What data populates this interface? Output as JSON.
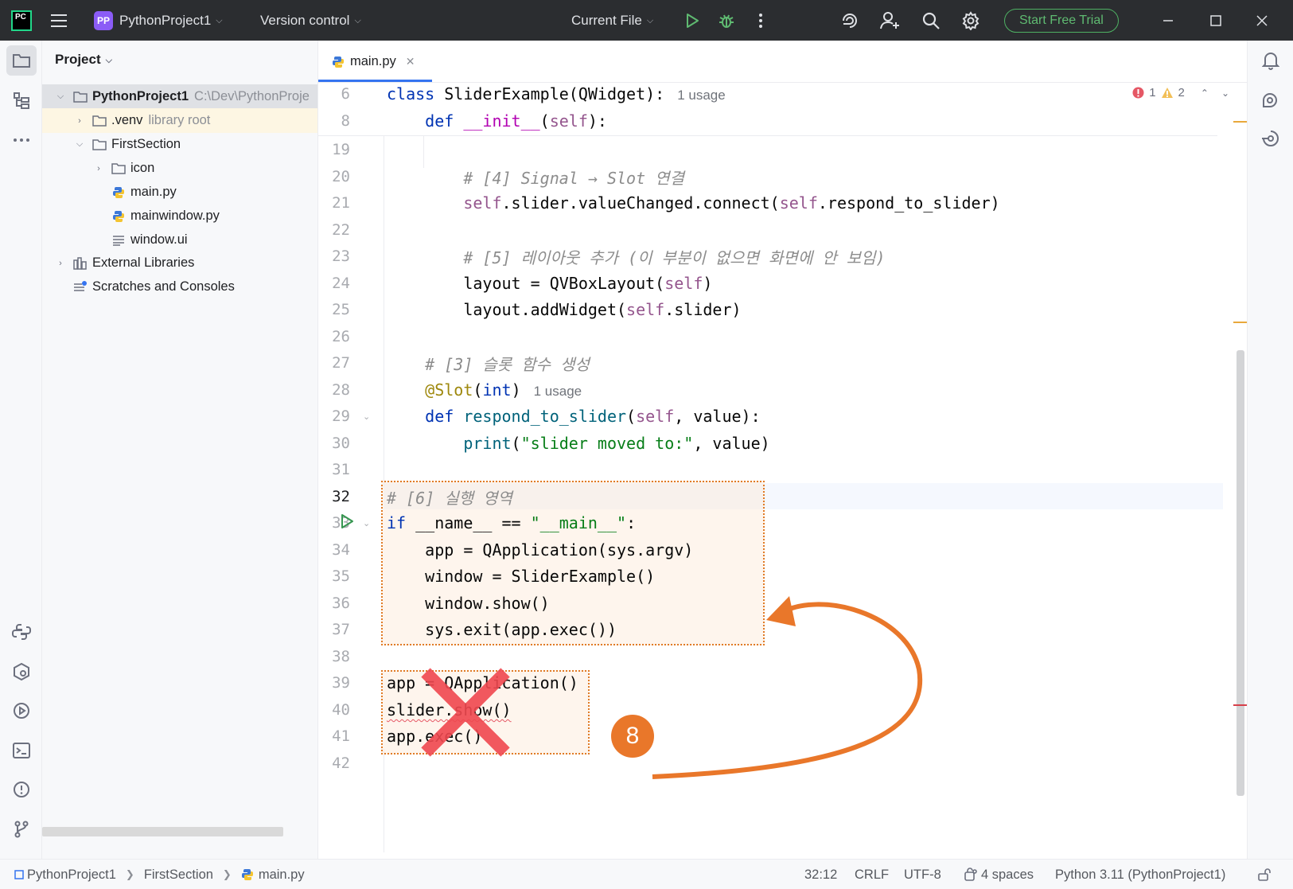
{
  "titlebar": {
    "logo_text": "PC",
    "project_badge": "PP",
    "project_name": "PythonProject1",
    "vcs_label": "Version control",
    "run_config": "Current File",
    "trial_button": "Start Free Trial"
  },
  "project_panel": {
    "title": "Project",
    "tree": [
      {
        "label": "PythonProject1",
        "extra": "C:\\Dev\\PythonProje"
      },
      {
        "label": ".venv",
        "extra": "library root"
      },
      {
        "label": "FirstSection",
        "extra": ""
      },
      {
        "label": "icon",
        "extra": ""
      },
      {
        "label": "main.py",
        "extra": ""
      },
      {
        "label": "mainwindow.py",
        "extra": ""
      },
      {
        "label": "window.ui",
        "extra": ""
      },
      {
        "label": "External Libraries",
        "extra": ""
      },
      {
        "label": "Scratches and Consoles",
        "extra": ""
      }
    ]
  },
  "editor": {
    "tab_label": "main.py",
    "errors": "1",
    "warnings": "2",
    "usage_hint": "1 usage",
    "lines": [
      {
        "n": "6",
        "text": "class SliderExample(QWidget):"
      },
      {
        "n": "8",
        "text": "    def __init__(self):"
      },
      {
        "n": "19",
        "text": ""
      },
      {
        "n": "20",
        "text": "        # [4] Signal → Slot 연결"
      },
      {
        "n": "21",
        "text": "        self.slider.valueChanged.connect(self.respond_to_slider)"
      },
      {
        "n": "22",
        "text": ""
      },
      {
        "n": "23",
        "text": "        # [5] 레이아웃 추가 (이 부분이 없으면 화면에 안 보임)"
      },
      {
        "n": "24",
        "text": "        layout = QVBoxLayout(self)"
      },
      {
        "n": "25",
        "text": "        layout.addWidget(self.slider)"
      },
      {
        "n": "26",
        "text": ""
      },
      {
        "n": "27",
        "text": "    # [3] 슬롯 함수 생성"
      },
      {
        "n": "28",
        "text": "    @Slot(int)"
      },
      {
        "n": "29",
        "text": "    def respond_to_slider(self, value):"
      },
      {
        "n": "30",
        "text": "        print(\"slider moved to:\", value)"
      },
      {
        "n": "31",
        "text": ""
      },
      {
        "n": "32",
        "text": "# [6] 실행 영역"
      },
      {
        "n": "33",
        "text": "if __name__ == \"__main__\":"
      },
      {
        "n": "34",
        "text": "    app = QApplication(sys.argv)"
      },
      {
        "n": "35",
        "text": "    window = SliderExample()"
      },
      {
        "n": "36",
        "text": "    window.show()"
      },
      {
        "n": "37",
        "text": "    sys.exit(app.exec())"
      },
      {
        "n": "38",
        "text": ""
      },
      {
        "n": "39",
        "text": "app = QApplication()"
      },
      {
        "n": "40",
        "text": "slider.show()"
      },
      {
        "n": "41",
        "text": "app.exec()"
      },
      {
        "n": "42",
        "text": ""
      }
    ]
  },
  "annotation": {
    "badge": "8",
    "color": "#e9772a"
  },
  "statusbar": {
    "breadcrumb": [
      "PythonProject1",
      "FirstSection",
      "main.py"
    ],
    "position": "32:12",
    "line_sep": "CRLF",
    "encoding": "UTF-8",
    "indent": "4 spaces",
    "interpreter": "Python 3.11 (PythonProject1)"
  }
}
